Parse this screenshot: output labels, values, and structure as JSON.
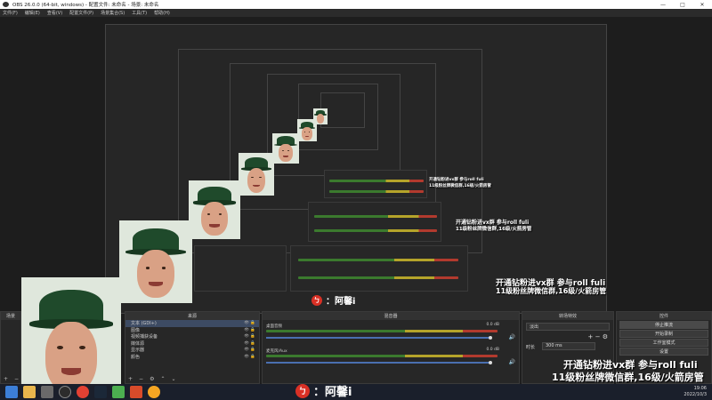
{
  "window": {
    "title": "OBS 26.0.0 (64-bit, windows) - 配置文件: 未命名 - 场景: 未命名",
    "buttons": [
      "—",
      "□",
      "✕"
    ]
  },
  "menu": [
    "文件(F)",
    "编辑(E)",
    "查看(V)",
    "配置文件(P)",
    "场景集合(S)",
    "工具(T)",
    "帮助(H)"
  ],
  "docks": {
    "scenes_title": "场景",
    "sources_title": "来源",
    "mixer_title": "混音器",
    "transitions_title": "转场特效",
    "controls_title": "控件"
  },
  "sources": [
    {
      "label": "文本 (GDI+)"
    },
    {
      "label": "图像"
    },
    {
      "label": "视频捕获设备"
    },
    {
      "label": "媒体源"
    },
    {
      "label": "显示器"
    },
    {
      "label": "颜色"
    }
  ],
  "mixer": {
    "tracks": [
      {
        "name": "桌面音频",
        "value": "0.0 dB",
        "level": 0.7
      },
      {
        "name": "麦克风/Aux",
        "value": "0.0 dB",
        "level": 0.45
      }
    ]
  },
  "transitions": {
    "selected": "淡出",
    "duration_label": "时长",
    "duration_value": "300 ms"
  },
  "controls": {
    "buttons": [
      "停止推流",
      "开始录制",
      "工作室模式",
      "设置"
    ]
  },
  "overlay": {
    "line1": "开通钻粉进vx群 参与roll fuli",
    "line2": "11级粉丝牌微信群,16级/火箭房管",
    "logo_text": "：阿馨i"
  },
  "taskbar": {
    "time": "19:06",
    "date": "2022/10/3"
  },
  "colors": {
    "accent_red": "#d93025",
    "dock_bg": "#272727",
    "selection": "#3d4b63"
  }
}
